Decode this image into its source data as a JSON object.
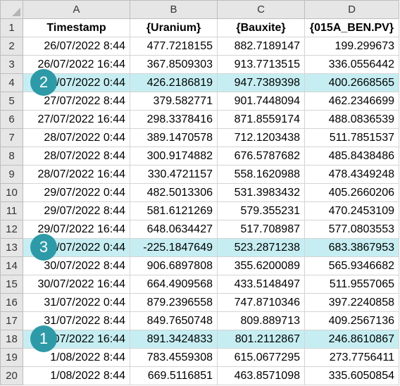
{
  "columns": [
    "A",
    "B",
    "C",
    "D"
  ],
  "header": [
    "Timestamp",
    "{Uranium}",
    "{Bauxite}",
    "{015A_BEN.PV}"
  ],
  "rows": [
    {
      "n": "2",
      "cells": [
        "26/07/2022 8:44",
        "477.7218155",
        "882.7189147",
        "199.299673"
      ]
    },
    {
      "n": "3",
      "cells": [
        "26/07/2022 16:44",
        "367.8509303",
        "913.7713515",
        "336.0556442"
      ]
    },
    {
      "n": "4",
      "cells": [
        "27/07/2022 0:44",
        "426.2186819",
        "947.7389398",
        "400.2668565"
      ]
    },
    {
      "n": "5",
      "cells": [
        "27/07/2022 8:44",
        "379.582771",
        "901.7448094",
        "462.2346699"
      ]
    },
    {
      "n": "6",
      "cells": [
        "27/07/2022 16:44",
        "298.3378416",
        "871.8559174",
        "488.0836539"
      ]
    },
    {
      "n": "7",
      "cells": [
        "28/07/2022 0:44",
        "389.1470578",
        "712.1203438",
        "511.7851537"
      ]
    },
    {
      "n": "8",
      "cells": [
        "28/07/2022 8:44",
        "300.9174882",
        "676.5787682",
        "485.8438486"
      ]
    },
    {
      "n": "9",
      "cells": [
        "28/07/2022 16:44",
        "330.4721157",
        "558.1620988",
        "478.4349248"
      ]
    },
    {
      "n": "10",
      "cells": [
        "29/07/2022 0:44",
        "482.5013306",
        "531.3983432",
        "405.2660206"
      ]
    },
    {
      "n": "11",
      "cells": [
        "29/07/2022 8:44",
        "581.6121269",
        "579.355231",
        "470.2453109"
      ]
    },
    {
      "n": "12",
      "cells": [
        "29/07/2022 16:44",
        "648.0634427",
        "517.708987",
        "577.0803553"
      ]
    },
    {
      "n": "13",
      "cells": [
        "30/07/2022 0:44",
        "-225.1847649",
        "523.2871238",
        "683.3867953"
      ]
    },
    {
      "n": "14",
      "cells": [
        "30/07/2022 8:44",
        "906.6897808",
        "355.6200089",
        "565.9346682"
      ]
    },
    {
      "n": "15",
      "cells": [
        "30/07/2022 16:44",
        "664.4909568",
        "433.5148497",
        "511.9557065"
      ]
    },
    {
      "n": "16",
      "cells": [
        "31/07/2022 0:44",
        "879.2396558",
        "747.8710346",
        "397.2240858"
      ]
    },
    {
      "n": "17",
      "cells": [
        "31/07/2022 8:44",
        "849.7650748",
        "809.889713",
        "409.2567136"
      ]
    },
    {
      "n": "18",
      "cells": [
        "31/07/2022 16:44",
        "891.3424833",
        "801.2112867",
        "246.8610867"
      ]
    },
    {
      "n": "19",
      "cells": [
        "1/08/2022 8:44",
        "783.4559308",
        "615.0677295",
        "273.7756411"
      ]
    },
    {
      "n": "20",
      "cells": [
        "1/08/2022 8:44",
        "669.5116851",
        "463.8571098",
        "335.6050854"
      ]
    }
  ],
  "highlight_color": "#c6eef2",
  "badge_color": "#2e9aa8",
  "badges": [
    {
      "label": "2",
      "row": "4"
    },
    {
      "label": "3",
      "row": "13"
    },
    {
      "label": "1",
      "row": "18"
    }
  ]
}
